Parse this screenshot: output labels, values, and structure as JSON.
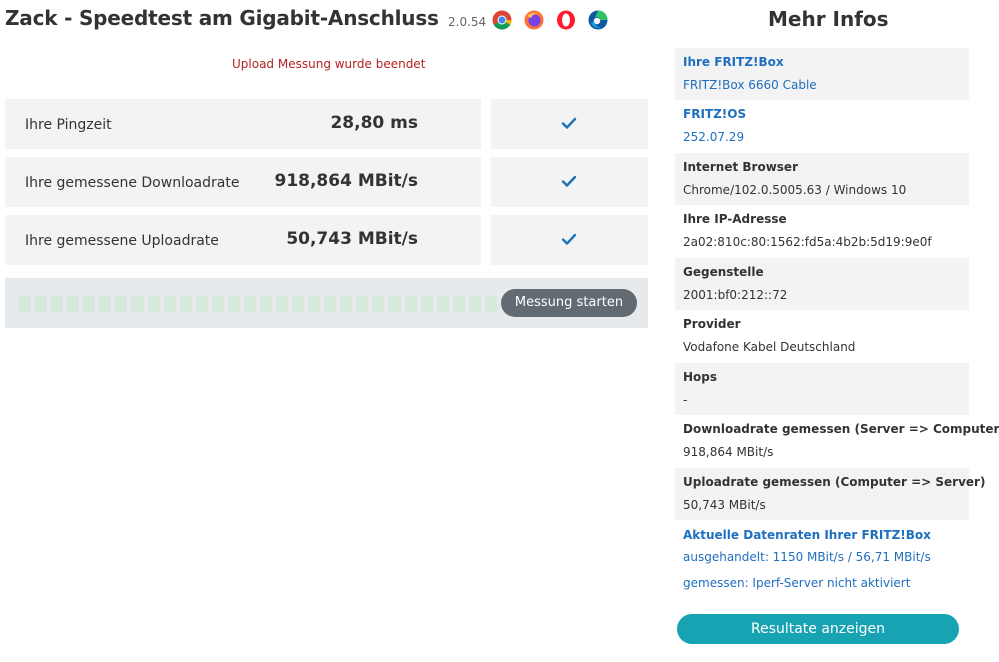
{
  "header": {
    "title": "Zack - Speedtest am Gigabit-Anschluss",
    "version": "2.0.54",
    "browser_icons": [
      "chrome-icon",
      "firefox-icon",
      "opera-icon",
      "edge-icon"
    ]
  },
  "status": {
    "message": "Upload Messung wurde beendet"
  },
  "results": [
    {
      "label": "Ihre Pingzeit",
      "value": "28,80 ms",
      "icon": "checkmark-icon"
    },
    {
      "label": "Ihre gemessene Downloadrate",
      "value": "918,864 MBit/s",
      "icon": "checkmark-icon"
    },
    {
      "label": "Ihre gemessene Uploadrate",
      "value": "50,743 MBit/s",
      "icon": "checkmark-icon"
    }
  ],
  "progress": {
    "fraction": 1.0,
    "segments": 30
  },
  "actions": {
    "start_label": "Messung starten",
    "results_label": "Resultate anzeigen"
  },
  "info": {
    "title": "Mehr Infos",
    "items": [
      {
        "key": "Ihre FRITZ!Box",
        "value": "FRITZ!Box 6660 Cable"
      },
      {
        "key": "FRITZ!OS",
        "value": "252.07.29"
      },
      {
        "key": "Internet Browser",
        "value": "Chrome/102.0.5005.63 / Windows 10"
      },
      {
        "key": "Ihre IP-Adresse",
        "value": "2a02:810c:80:1562:fd5a:4b2b:5d19:9e0f"
      },
      {
        "key": "Gegenstelle",
        "value": "2001:bf0:212::72"
      },
      {
        "key": "Provider",
        "value": "Vodafone Kabel Deutschland"
      },
      {
        "key": "Hops",
        "value": "-"
      },
      {
        "key": "Downloadrate gemessen (Server => Computer)",
        "value": "918,864 MBit/s"
      },
      {
        "key": "Uploadrate gemessen (Computer => Server)",
        "value": "50,743 MBit/s"
      }
    ],
    "rates": {
      "title": "Aktuelle Datenraten Ihrer FRITZ!Box",
      "negotiated": "ausgehandelt: 1150 MBit/s / 56,71 MBit/s",
      "measured": "gemessen: Iperf-Server nicht aktiviert"
    }
  },
  "colors": {
    "accent_blue": "#1f6fbf",
    "status_red": "#b22222",
    "check_blue": "#1a73b8",
    "teal_button": "#17a3b2",
    "gray_button": "#626b72"
  }
}
